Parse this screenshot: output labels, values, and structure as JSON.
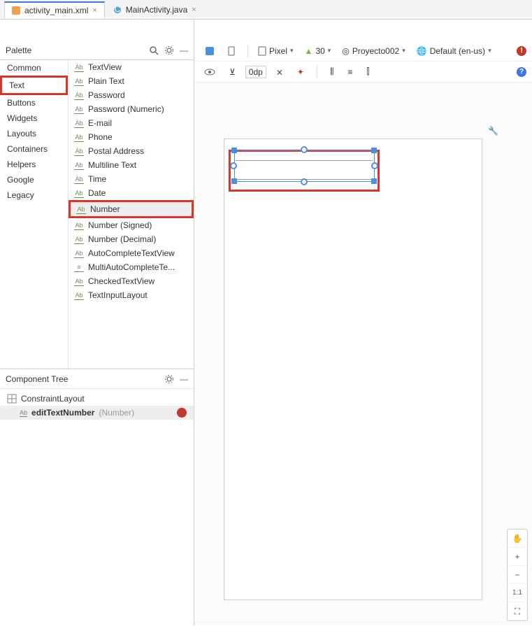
{
  "tabs": [
    {
      "label": "activity_main.xml",
      "active": true
    },
    {
      "label": "MainActivity.java",
      "active": false
    }
  ],
  "palette": {
    "title": "Palette",
    "categories": [
      "Common",
      "Text",
      "Buttons",
      "Widgets",
      "Layouts",
      "Containers",
      "Helpers",
      "Google",
      "Legacy"
    ],
    "items": [
      "TextView",
      "Plain Text",
      "Password",
      "Password (Numeric)",
      "E-mail",
      "Phone",
      "Postal Address",
      "Multiline Text",
      "Time",
      "Date",
      "Number",
      "Number (Signed)",
      "Number (Decimal)",
      "AutoCompleteTextView",
      "MultiAutoCompleteTe...",
      "CheckedTextView",
      "TextInputLayout"
    ]
  },
  "tree": {
    "title": "Component Tree",
    "root": "ConstraintLayout",
    "child_name": "editTextNumber",
    "child_hint": "(Number)"
  },
  "toolbar": {
    "device": "Pixel",
    "api": "30",
    "project": "Proyecto002",
    "locale": "Default (en-us)",
    "margin": "0dp"
  },
  "zoom": {
    "plus": "+",
    "minus": "−",
    "ratio": "1:1",
    "pan": "✋",
    "fit": "⛶"
  }
}
